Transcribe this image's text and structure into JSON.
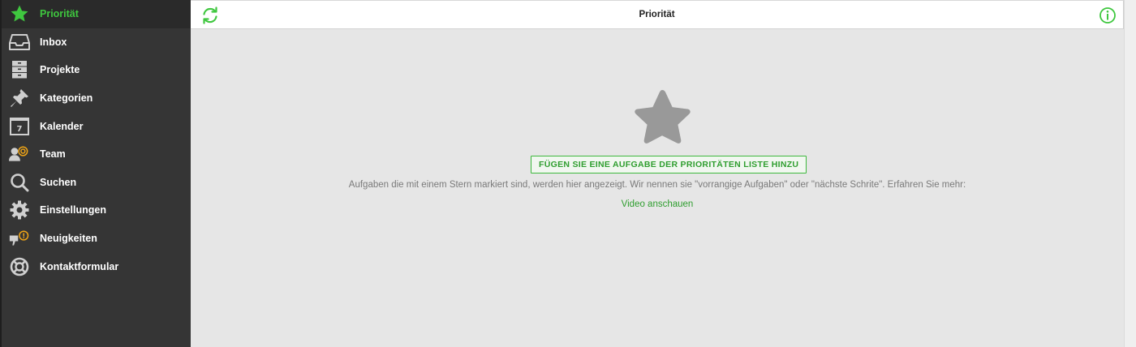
{
  "sidebar": {
    "items": [
      {
        "label": "Priorität",
        "icon": "star-icon",
        "active": true
      },
      {
        "label": "Inbox",
        "icon": "inbox-icon"
      },
      {
        "label": "Projekte",
        "icon": "projects-icon"
      },
      {
        "label": "Kategorien",
        "icon": "pin-icon"
      },
      {
        "label": "Kalender",
        "icon": "calendar-icon"
      },
      {
        "label": "Team",
        "icon": "team-icon"
      },
      {
        "label": "Suchen",
        "icon": "search-icon"
      },
      {
        "label": "Einstellungen",
        "icon": "gear-icon"
      },
      {
        "label": "Neuigkeiten",
        "icon": "news-icon"
      },
      {
        "label": "Kontaktformular",
        "icon": "lifebuoy-icon"
      }
    ],
    "calendar_day": "7",
    "news_badge": "!"
  },
  "header": {
    "title": "Priorität"
  },
  "empty_state": {
    "button_label": "FÜGEN SIE EINE AUFGABE DER PRIORITÄTEN LISTE HINZU",
    "description": "Aufgaben die mit einem Stern markiert sind, werden hier angezeigt. Wir nennen sie \"vorrangige Aufgaben\" oder \"nächste Schrite\". Erfahren Sie mehr:",
    "link_label": "Video anschauen"
  },
  "colors": {
    "accent": "#3fc73f",
    "sidebar_bg": "#353535",
    "content_bg": "#e6e6e6",
    "badge_orange": "#f0a516"
  }
}
